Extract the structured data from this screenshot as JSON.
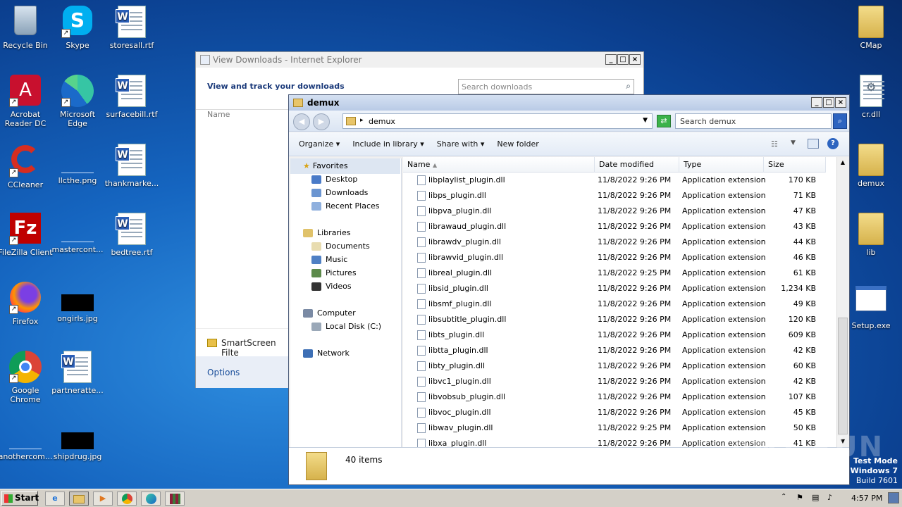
{
  "desktop": {
    "col1": [
      {
        "label": "Recycle Bin",
        "icon": "recycle-bin-icon"
      },
      {
        "label": "Acrobat Reader DC",
        "icon": "acrobat-icon"
      },
      {
        "label": "CCleaner",
        "icon": "ccleaner-icon"
      },
      {
        "label": "FileZilla Client",
        "icon": "filezilla-icon"
      },
      {
        "label": "Firefox",
        "icon": "firefox-icon"
      },
      {
        "label": "Google Chrome",
        "icon": "chrome-icon"
      },
      {
        "label": "anothercom...",
        "icon": "file-icon"
      }
    ],
    "col2": [
      {
        "label": "Skype",
        "icon": "skype-icon"
      },
      {
        "label": "Microsoft Edge",
        "icon": "edge-icon"
      },
      {
        "label": "llcthe.png",
        "icon": "image-icon"
      },
      {
        "label": "mastercont...",
        "icon": "file-icon"
      },
      {
        "label": "ongirls.jpg",
        "icon": "image-icon"
      },
      {
        "label": "partneratte...",
        "icon": "word-doc-icon"
      },
      {
        "label": "shipdrug.jpg",
        "icon": "image-icon"
      }
    ],
    "col3": [
      {
        "label": "storesall.rtf",
        "icon": "word-doc-icon"
      },
      {
        "label": "surfacebill.rtf",
        "icon": "word-doc-icon"
      },
      {
        "label": "thankmarke...",
        "icon": "word-doc-icon"
      },
      {
        "label": "bedtree.rtf",
        "icon": "word-doc-icon"
      }
    ],
    "right": [
      {
        "label": "CMap",
        "icon": "folder-icon"
      },
      {
        "label": "cr.dll",
        "icon": "dll-icon"
      },
      {
        "label": "demux",
        "icon": "folder-icon"
      },
      {
        "label": "lib",
        "icon": "folder-icon"
      },
      {
        "label": "Setup.exe",
        "icon": "exe-icon"
      }
    ]
  },
  "ie_window": {
    "title": "View Downloads - Internet Explorer",
    "heading": "View and track your downloads",
    "search_placeholder": "Search downloads",
    "col_name": "Name",
    "smartscreen": "SmartScreen Filte",
    "options": "Options"
  },
  "explorer": {
    "title": "demux",
    "path": "demux",
    "search_placeholder": "Search demux",
    "toolbar": {
      "organize": "Organize",
      "include": "Include in library",
      "share": "Share with",
      "new_folder": "New folder"
    },
    "nav": {
      "favorites": "Favorites",
      "desktop": "Desktop",
      "downloads": "Downloads",
      "recent": "Recent Places",
      "libraries": "Libraries",
      "documents": "Documents",
      "music": "Music",
      "pictures": "Pictures",
      "videos": "Videos",
      "computer": "Computer",
      "local_disk": "Local Disk (C:)",
      "network": "Network"
    },
    "columns": {
      "name": "Name",
      "date": "Date modified",
      "type": "Type",
      "size": "Size"
    },
    "files": [
      {
        "name": "libplaylist_plugin.dll",
        "date": "11/8/2022 9:26 PM",
        "type": "Application extension",
        "size": "170 KB"
      },
      {
        "name": "libps_plugin.dll",
        "date": "11/8/2022 9:26 PM",
        "type": "Application extension",
        "size": "71 KB"
      },
      {
        "name": "libpva_plugin.dll",
        "date": "11/8/2022 9:26 PM",
        "type": "Application extension",
        "size": "47 KB"
      },
      {
        "name": "librawaud_plugin.dll",
        "date": "11/8/2022 9:26 PM",
        "type": "Application extension",
        "size": "43 KB"
      },
      {
        "name": "librawdv_plugin.dll",
        "date": "11/8/2022 9:26 PM",
        "type": "Application extension",
        "size": "44 KB"
      },
      {
        "name": "librawvid_plugin.dll",
        "date": "11/8/2022 9:26 PM",
        "type": "Application extension",
        "size": "46 KB"
      },
      {
        "name": "libreal_plugin.dll",
        "date": "11/8/2022 9:25 PM",
        "type": "Application extension",
        "size": "61 KB"
      },
      {
        "name": "libsid_plugin.dll",
        "date": "11/8/2022 9:26 PM",
        "type": "Application extension",
        "size": "1,234 KB"
      },
      {
        "name": "libsmf_plugin.dll",
        "date": "11/8/2022 9:26 PM",
        "type": "Application extension",
        "size": "49 KB"
      },
      {
        "name": "libsubtitle_plugin.dll",
        "date": "11/8/2022 9:26 PM",
        "type": "Application extension",
        "size": "120 KB"
      },
      {
        "name": "libts_plugin.dll",
        "date": "11/8/2022 9:26 PM",
        "type": "Application extension",
        "size": "609 KB"
      },
      {
        "name": "libtta_plugin.dll",
        "date": "11/8/2022 9:26 PM",
        "type": "Application extension",
        "size": "42 KB"
      },
      {
        "name": "libty_plugin.dll",
        "date": "11/8/2022 9:26 PM",
        "type": "Application extension",
        "size": "60 KB"
      },
      {
        "name": "libvc1_plugin.dll",
        "date": "11/8/2022 9:26 PM",
        "type": "Application extension",
        "size": "42 KB"
      },
      {
        "name": "libvobsub_plugin.dll",
        "date": "11/8/2022 9:26 PM",
        "type": "Application extension",
        "size": "107 KB"
      },
      {
        "name": "libvoc_plugin.dll",
        "date": "11/8/2022 9:26 PM",
        "type": "Application extension",
        "size": "45 KB"
      },
      {
        "name": "libwav_plugin.dll",
        "date": "11/8/2022 9:25 PM",
        "type": "Application extension",
        "size": "50 KB"
      },
      {
        "name": "libxa_plugin.dll",
        "date": "11/8/2022 9:26 PM",
        "type": "Application extension",
        "size": "41 KB"
      }
    ],
    "status": "40 items"
  },
  "watermark": {
    "test_mode": "Test Mode",
    "os": "Windows 7",
    "build": "Build 7601",
    "brand": "ANY RUN"
  },
  "taskbar": {
    "start": "Start",
    "clock": "4:57 PM"
  }
}
